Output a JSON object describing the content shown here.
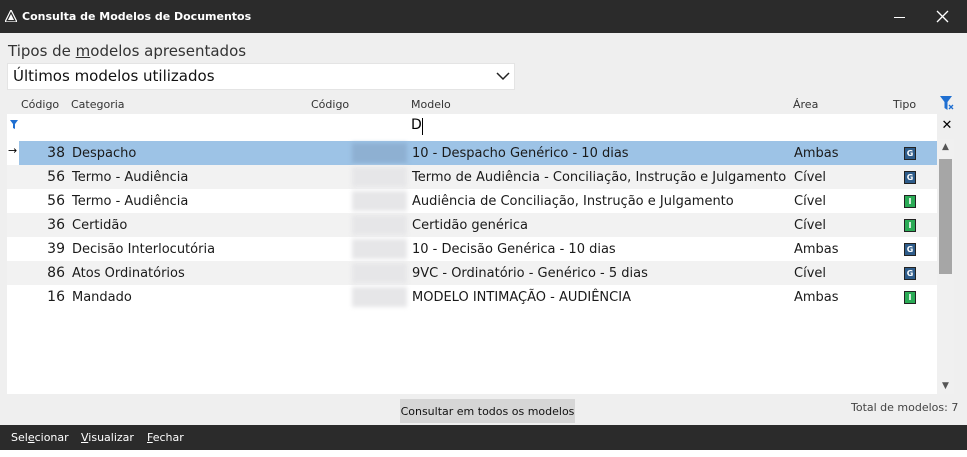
{
  "window": {
    "title": "Consulta de Modelos de Documentos",
    "icon": "app-triangle-icon"
  },
  "filter": {
    "label_pre": "Tipos de ",
    "label_underlined": "m",
    "label_post": "odelos apresentados",
    "selected": "Últimos modelos utilizados"
  },
  "columns": {
    "codigo": "Código",
    "categoria": "Categoria",
    "codigo_modelo": "Código",
    "modelo": "Modelo",
    "area": "Área",
    "tipo": "Tipo"
  },
  "filter_row": {
    "modelo_value": "D"
  },
  "rows": [
    {
      "codigo": "38",
      "categoria": "Despacho",
      "modelo": "10 - Despacho Genérico - 10 dias",
      "area": "Ambas",
      "tipo": "G",
      "selected": true
    },
    {
      "codigo": "56",
      "categoria": "Termo - Audiência",
      "modelo": "Termo de Audiência - Conciliação, Instrução e Julgamento",
      "area": "Cível",
      "tipo": "G"
    },
    {
      "codigo": "56",
      "categoria": "Termo - Audiência",
      "modelo": "Audiência de Conciliação, Instrução e Julgamento",
      "area": "Cível",
      "tipo": "I"
    },
    {
      "codigo": "36",
      "categoria": "Certidão",
      "modelo": "Certidão genérica",
      "area": "Cível",
      "tipo": "I"
    },
    {
      "codigo": "39",
      "categoria": "Decisão Interlocutória",
      "modelo": "10 - Decisão Genérica - 10 dias",
      "area": "Ambas",
      "tipo": "G"
    },
    {
      "codigo": "86",
      "categoria": "Atos Ordinatórios",
      "modelo": "9VC - Ordinatório - Genérico - 5 dias",
      "area": "Cível",
      "tipo": "G"
    },
    {
      "codigo": "16",
      "categoria": "Mandado",
      "modelo": "MODELO INTIMAÇÃO - AUDIÊNCIA",
      "area": "Ambas",
      "tipo": "I"
    }
  ],
  "buttons": {
    "search_all": "Consultar em todos os modelos"
  },
  "total_label": "Total de modelos: 7",
  "actions": {
    "select_pre": "Sel",
    "select_u": "e",
    "select_post": "cionar",
    "view_u": "V",
    "view_post": "isualizar",
    "close_u": "F",
    "close_post": "echar"
  },
  "colors": {
    "titlebar": "#2b2b2b",
    "selection": "#9dc3e6",
    "type_g": "#2e5c8a",
    "type_i": "#2bab56"
  }
}
